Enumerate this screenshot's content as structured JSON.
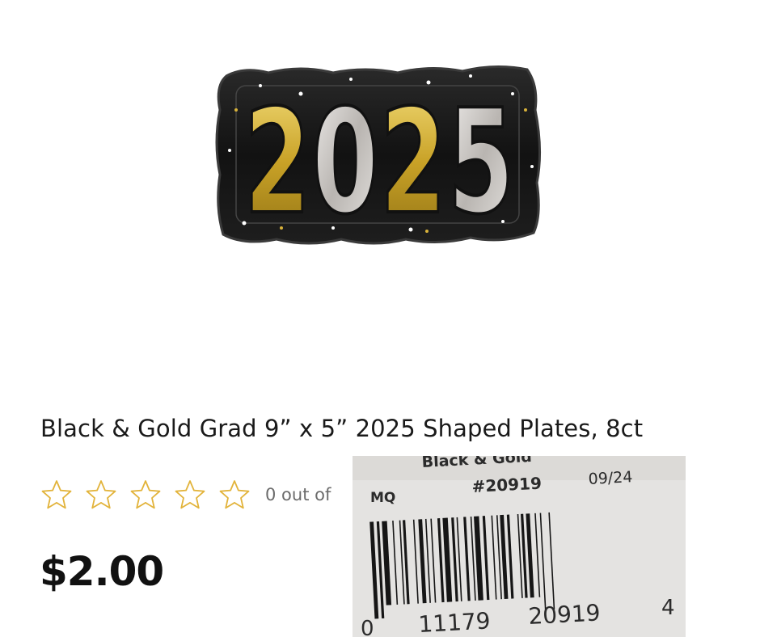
{
  "product": {
    "title": "Black & Gold Grad 9” x 5” 2025 Shaped Plates, 8ct",
    "plate_text": "2025",
    "price": "$2.00",
    "rating": {
      "stars_filled": 0,
      "stars_total": 5,
      "label": "0 out of"
    }
  },
  "barcode_label": {
    "header_text": "Black & Gold",
    "code_prefix": "MQ",
    "item_number": "#20919",
    "date": "09/24",
    "digit_left": "0",
    "group1": "11179",
    "group2": "20919",
    "digit_right": "4"
  },
  "colors": {
    "star_outline": "#e2b33a",
    "gold": "#c9a227",
    "silver": "#d9d6d2",
    "plate_black": "#151515",
    "rating_text": "#6b6b6b"
  },
  "icons": {
    "rating_star": "star-outline-icon"
  }
}
